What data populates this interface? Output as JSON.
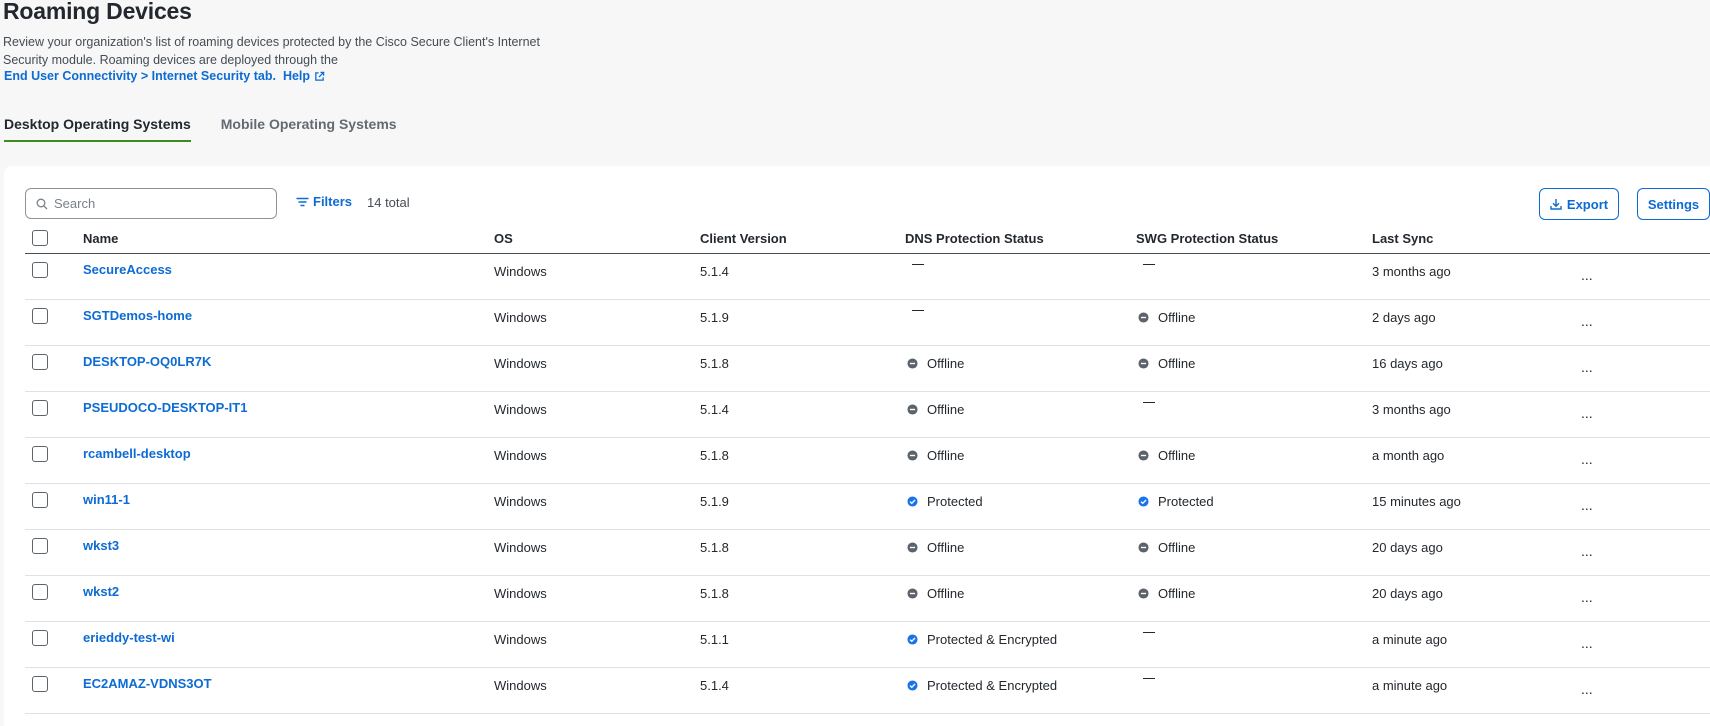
{
  "page": {
    "title": "Roaming Devices",
    "description": "Review your organization's list of roaming devices protected by the Cisco Secure Client's Internet Security module. Roaming devices are deployed through the",
    "link_text": "End User Connectivity > Internet Security tab.",
    "help_text": "Help"
  },
  "tabs": [
    {
      "label": "Desktop Operating Systems",
      "active": true
    },
    {
      "label": "Mobile Operating Systems",
      "active": false
    }
  ],
  "toolbar": {
    "search_placeholder": "Search",
    "filters_label": "Filters",
    "total_text": "14 total",
    "export_label": "Export",
    "settings_label": "Settings"
  },
  "table": {
    "columns": [
      "Name",
      "OS",
      "Client Version",
      "DNS Protection Status",
      "SWG Protection Status",
      "Last Sync"
    ],
    "more_label": "...",
    "rows": [
      {
        "name": "SecureAccess",
        "os": "Windows",
        "version": "5.1.4",
        "dns": "",
        "swg": "",
        "sync": "3 months ago"
      },
      {
        "name": "SGTDemos-home",
        "os": "Windows",
        "version": "5.1.9",
        "dns": "",
        "swg": "Offline",
        "sync": "2 days ago"
      },
      {
        "name": "DESKTOP-OQ0LR7K",
        "os": "Windows",
        "version": "5.1.8",
        "dns": "Offline",
        "swg": "Offline",
        "sync": "16 days ago"
      },
      {
        "name": "PSEUDOCO-DESKTOP-IT1",
        "os": "Windows",
        "version": "5.1.4",
        "dns": "Offline",
        "swg": "",
        "sync": "3 months ago"
      },
      {
        "name": "rcambell-desktop",
        "os": "Windows",
        "version": "5.1.8",
        "dns": "Offline",
        "swg": "Offline",
        "sync": "a month ago"
      },
      {
        "name": "win11-1",
        "os": "Windows",
        "version": "5.1.9",
        "dns": "Protected",
        "swg": "Protected",
        "sync": "15 minutes ago"
      },
      {
        "name": "wkst3",
        "os": "Windows",
        "version": "5.1.8",
        "dns": "Offline",
        "swg": "Offline",
        "sync": "20 days ago"
      },
      {
        "name": "wkst2",
        "os": "Windows",
        "version": "5.1.8",
        "dns": "Offline",
        "swg": "Offline",
        "sync": "20 days ago"
      },
      {
        "name": "erieddy-test-wi",
        "os": "Windows",
        "version": "5.1.1",
        "dns": "Protected & Encrypted",
        "swg": "",
        "sync": "a minute ago"
      },
      {
        "name": "EC2AMAZ-VDNS3OT",
        "os": "Windows",
        "version": "5.1.4",
        "dns": "Protected & Encrypted",
        "swg": "",
        "sync": "a minute ago"
      }
    ]
  },
  "colors": {
    "link": "#0d6bd4",
    "tab_underline": "#3c8c1e",
    "offline_icon": "#5d636b",
    "protected_icon": "#1a73e8"
  },
  "icons": {
    "search": "search-icon",
    "filter": "filter-icon",
    "export": "download-icon",
    "external": "external-link-icon",
    "offline": "offline-minus-circle-icon",
    "protected": "check-circle-icon"
  }
}
